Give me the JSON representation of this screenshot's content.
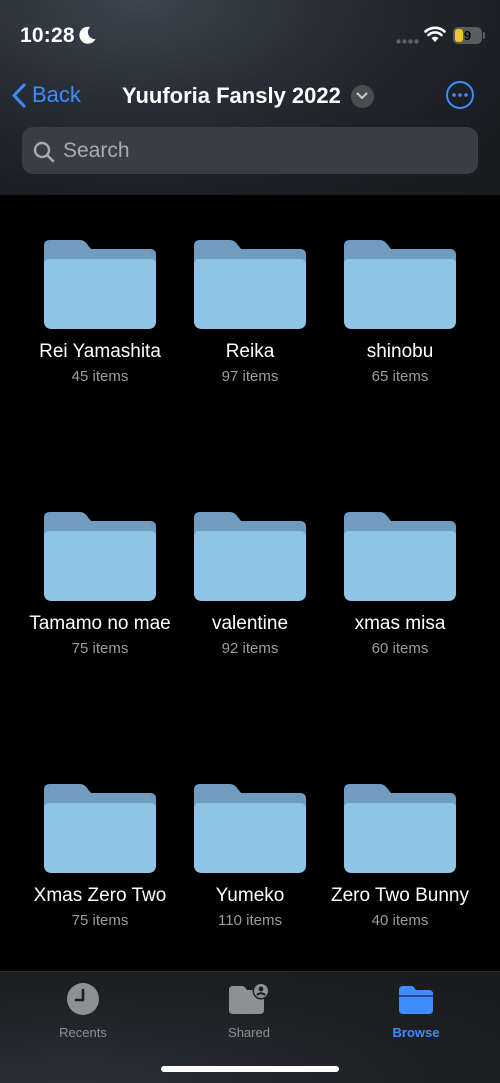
{
  "status_bar": {
    "time": "10:28",
    "battery_level": "9",
    "icons": [
      "moon-icon",
      "cellular-dots-icon",
      "wifi-icon",
      "battery-icon"
    ]
  },
  "nav": {
    "back_label": "Back",
    "title": "Yuuforia Fansly 2022"
  },
  "search": {
    "placeholder": "Search"
  },
  "folders": [
    {
      "name": "Rei Yamashita",
      "count": "45 items"
    },
    {
      "name": "Reika",
      "count": "97 items"
    },
    {
      "name": "shinobu",
      "count": "65 items"
    },
    {
      "name": "Tamamo no mae",
      "count": "75 items"
    },
    {
      "name": "valentine",
      "count": "92 items"
    },
    {
      "name": "xmas misa",
      "count": "60 items"
    },
    {
      "name": "Xmas Zero Two",
      "count": "75 items"
    },
    {
      "name": "Yumeko",
      "count": "110 items"
    },
    {
      "name": "Zero Two Bunny",
      "count": "40 items"
    }
  ],
  "tabs": [
    {
      "label": "Recents",
      "icon": "clock-icon",
      "active": false
    },
    {
      "label": "Shared",
      "icon": "shared-folder-icon",
      "active": false
    },
    {
      "label": "Browse",
      "icon": "folder-icon",
      "active": true
    }
  ],
  "colors": {
    "accent": "#3d8dff",
    "folder_front": "#8fc3e8",
    "folder_back": "#6f9cbf",
    "background": "#000000"
  }
}
